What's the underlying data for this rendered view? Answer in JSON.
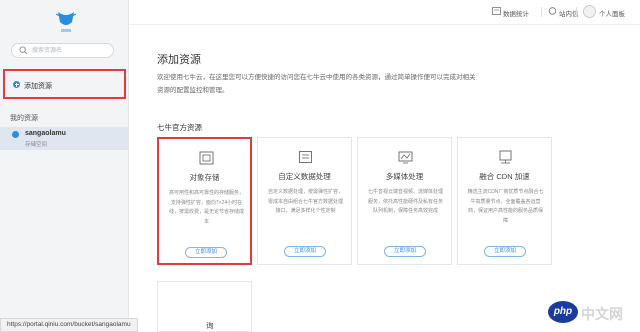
{
  "sidebar": {
    "search_placeholder": "搜索资源名",
    "add_resource": "添加资源",
    "my_resources": "我的资源",
    "bucket_name": "sangaolamu",
    "bucket_type": "存储空间"
  },
  "topbar": {
    "stats": "数据统计",
    "messages": "站内信",
    "user": "个人面板"
  },
  "main": {
    "title": "添加资源",
    "intro": "欢迎使用七牛云，在这里您可以方便快捷的访问您在七牛云中使用的各类资源，通过简单操作便可以完成对相关资源的配置监控和管理。",
    "section_title": "七牛官方资源",
    "cards": [
      {
        "title": "对象存储",
        "desc": "高可用性和高可靠性的存储服务，支持弹性扩容，面向7×24小时在线，按需收费，是无论节省存储成本",
        "button": "立即添加"
      },
      {
        "title": "自定义数据处理",
        "desc": "自定义数据处理，按需弹性扩容，零成本自由组合七牛官方数据处理接口，满足多样化个性定制",
        "button": "立即添加"
      },
      {
        "title": "多媒体处理",
        "desc": "七牛音视云端音视频、流媒体处理服务，依托高性能硬件及私有任务队列机制，保障任务高效完成",
        "button": "立即添加"
      },
      {
        "title": "融合 CDN 加速",
        "desc": "精选主流CDN厂商优质节点融合七牛高质量节点，全面覆盖各运营商，保证用户高性能的服务品质保障",
        "button": "立即添加"
      }
    ],
    "card5_title_partial": "询"
  },
  "status_url": "https://portal.qiniu.com/bucket/sangaolamu",
  "watermark": {
    "badge": "php",
    "text": "中文网"
  },
  "colors": {
    "accent": "#2a8ee0",
    "highlight": "#e23b3b"
  }
}
